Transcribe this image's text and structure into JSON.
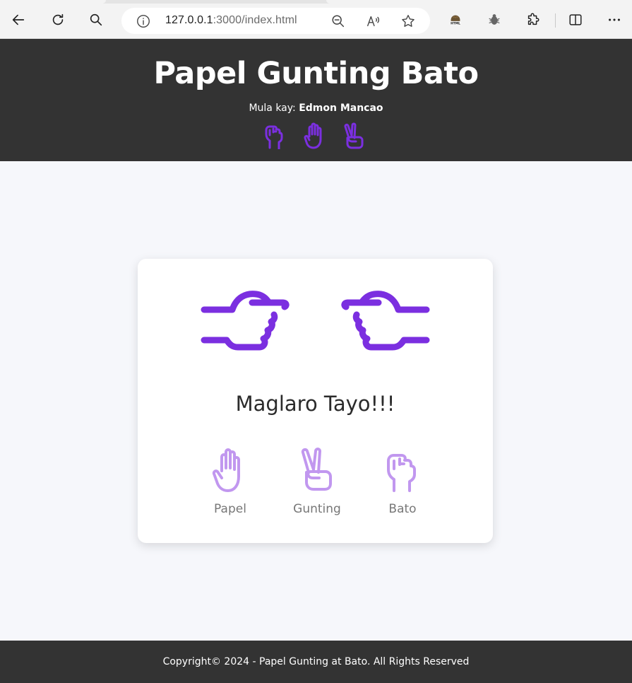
{
  "browser": {
    "url_host": "127.0.0.1",
    "url_rest": ":3000/index.html",
    "icons": [
      "back-icon",
      "reload-icon",
      "search-icon",
      "info-icon",
      "zoom-out-icon",
      "read-aloud-icon",
      "favorite-star-icon",
      "html-extension-icon",
      "bug-extension-icon",
      "extensions-puzzle-icon",
      "split-screen-icon",
      "more-icon"
    ]
  },
  "header": {
    "title": "Papel Gunting Bato",
    "byline_prefix": "Mula kay:",
    "byline_author": "Edmon Mancao",
    "icons": [
      "rock-hand-icon",
      "paper-hand-icon",
      "scissors-hand-icon"
    ]
  },
  "game": {
    "headline": "Maglaro Tayo!!!",
    "player_hand_icon": "fist-pointing-right-icon",
    "computer_hand_icon": "fist-pointing-left-icon",
    "choices": [
      {
        "label": "Papel",
        "icon": "paper-hand-icon"
      },
      {
        "label": "Gunting",
        "icon": "scissors-hand-icon"
      },
      {
        "label": "Bato",
        "icon": "rock-hand-icon"
      }
    ]
  },
  "footer": {
    "text": "Copyright© 2024 - Papel Gunting at Bato. All Rights Reserved"
  },
  "colors": {
    "accent": "#7b2fe0",
    "accent_light": "#c197ef",
    "dark": "#333333",
    "page_bg": "#f6f7fb"
  }
}
